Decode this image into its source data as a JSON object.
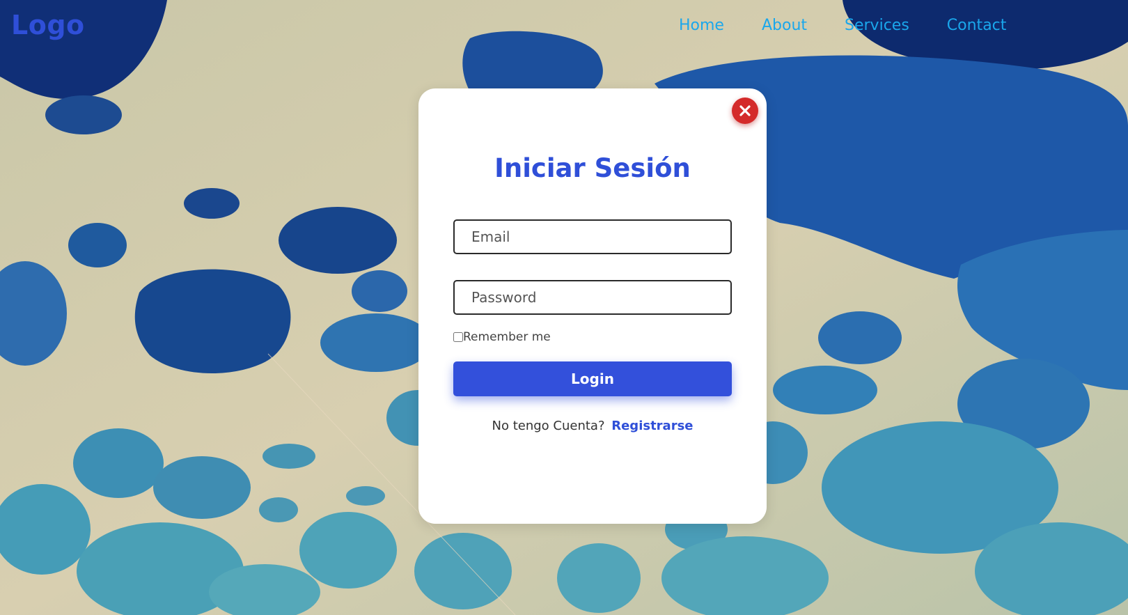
{
  "header": {
    "logo": "Logo",
    "nav": [
      "Home",
      "About",
      "Services",
      "Contact"
    ]
  },
  "login_modal": {
    "title": "Iniciar Sesión",
    "email_placeholder": "Email",
    "password_placeholder": "Password",
    "remember_label": "Remember me",
    "remember_checked": false,
    "login_label": "Login",
    "signup_prompt": "No tengo Cuenta?",
    "signup_link": "Registrarse"
  },
  "colors": {
    "brand": "#2f4fd8",
    "nav_link": "#1aa7ec",
    "close_button": "#d42a2a",
    "login_button": "#3350db"
  },
  "icons": {
    "close": "close-icon"
  }
}
